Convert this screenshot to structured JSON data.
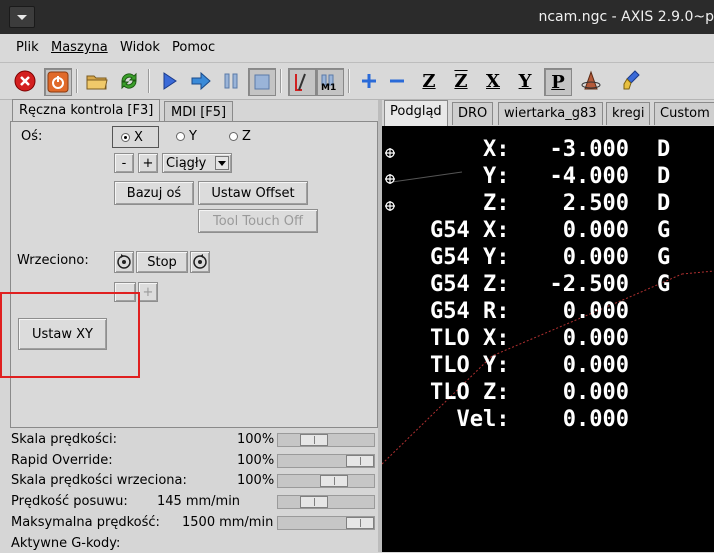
{
  "window": {
    "title": "ncam.ngc - AXIS 2.9.0~p"
  },
  "menubar": [
    "Plik",
    "Maszyna",
    "Widok",
    "Pomoc"
  ],
  "toolbar": {
    "icons": [
      "estop-icon",
      "power-icon",
      "open-file-icon",
      "reload-icon",
      "run-icon",
      "step-icon",
      "pause-icon",
      "stop-icon",
      "block-delete-icon",
      "optional-stop-icon",
      "zoom-in-icon",
      "zoom-out-icon",
      "view-z-icon",
      "view-z2-icon",
      "view-x-icon",
      "view-y-icon",
      "view-p-icon",
      "rotate-view-icon",
      "clear-backplot-icon"
    ],
    "letters": {
      "z": "Z",
      "z2": "Z",
      "x": "X",
      "y": "Y",
      "p": "P"
    },
    "m1": "M1"
  },
  "left_tabs": [
    "Ręczna kontrola [F3]",
    "MDI [F5]"
  ],
  "manual": {
    "axis_label": "Oś:",
    "axes": [
      "X",
      "Y",
      "Z"
    ],
    "selected_axis": "X",
    "minus": "-",
    "plus": "+",
    "jog_mode": "Ciągły",
    "home_button": "Bazuj oś",
    "offset_button": "Ustaw Offset",
    "touch_off_button": "Tool Touch Off",
    "spindle_label": "Wrzeciono:",
    "spindle_stop": "Stop",
    "spindle_minus": "-",
    "spindle_plus": "+",
    "set_xy_button": "Ustaw XY"
  },
  "sliders": [
    {
      "label": "Skala prędkości:",
      "value": "100",
      "unit": "%",
      "level": 0.45
    },
    {
      "label": "Rapid Override:",
      "value": "100",
      "unit": "%",
      "level": 1.0
    },
    {
      "label": "Skala prędkości wrzeciona:",
      "value": "100",
      "unit": "%",
      "level": 0.85
    },
    {
      "label": "Prędkość posuwu:",
      "value": "145",
      "unit": "mm/min",
      "level": 0.45
    },
    {
      "label": "Maksymalna prędkość:",
      "value": "1500",
      "unit": "mm/min",
      "level": 1.0
    }
  ],
  "active_gcodes_label": "Aktywne G-kody:",
  "right_tabs": [
    "Podgląd",
    "DRO",
    "wiertarka_g83",
    "kregi",
    "Custom"
  ],
  "dro": [
    {
      "label": "    X:",
      "value": "-3.000",
      "suffix": "D"
    },
    {
      "label": "    Y:",
      "value": "-4.000",
      "suffix": "D"
    },
    {
      "label": "    Z:",
      "value": " 2.500",
      "suffix": "D"
    },
    {
      "label": "G54 X:",
      "value": " 0.000",
      "suffix": "G"
    },
    {
      "label": "G54 Y:",
      "value": " 0.000",
      "suffix": "G"
    },
    {
      "label": "G54 Z:",
      "value": "-2.500",
      "suffix": "G"
    },
    {
      "label": "G54 R:",
      "value": " 0.000",
      "suffix": ""
    },
    {
      "label": "TLO X:",
      "value": " 0.000",
      "suffix": ""
    },
    {
      "label": "TLO Y:",
      "value": " 0.000",
      "suffix": ""
    },
    {
      "label": "TLO Z:",
      "value": " 0.000",
      "suffix": ""
    },
    {
      "label": "  Vel:",
      "value": " 0.000",
      "suffix": ""
    }
  ]
}
